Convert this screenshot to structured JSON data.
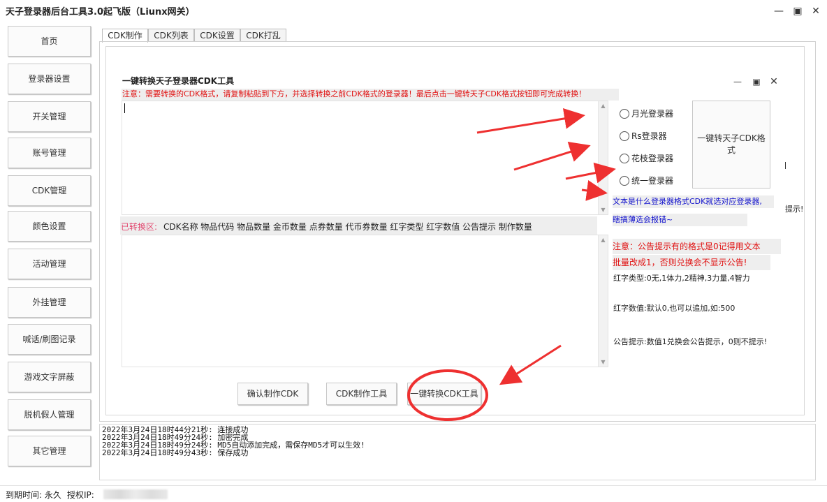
{
  "window": {
    "title": "天子登录器后台工具3.0起飞版（Liunx网关）"
  },
  "nav": [
    "首页",
    "登录器设置",
    "开关管理",
    "账号管理",
    "CDK管理",
    "颜色设置",
    "活动管理",
    "外挂管理",
    "喊话/刷图记录",
    "游戏文字屏蔽",
    "脱机假人管理",
    "其它管理"
  ],
  "tabs": [
    "CDK制作",
    "CDK列表",
    "CDK设置",
    "CDK打乱"
  ],
  "tool": {
    "title": "一键转换天子登录器CDK工具",
    "notice": "注意：需要转换的CDK格式，请复制粘贴到下方，并选择转换之前CDK格式的登录器！最后点击一键转天子CDK格式按钮即可完成转换！",
    "converted_label": "已转换区:",
    "converted_columns": "CDK名称 物品代码 物品数量 金币数量 点券数量 代币券数量 红字类型 红字数值 公告提示 制作数量",
    "radios": [
      "月光登录器",
      "Rs登录器",
      "花枝登录器",
      "统一登录器"
    ],
    "convert_button": "一键转天子CDK格式",
    "hint_line1": "文本是什么登录器格式CDK就选对应登录器,",
    "hint_line2": "瞎搞薄选会报错~",
    "side_clip": "提示!",
    "warn_line1": "注意：公告提示有的格式是0记得用文本",
    "warn_line2": "批量改成1，否则兑换会不显示公告!",
    "info_red_type": "红字类型:0无,1体力,2精神,3力量,4智力",
    "info_red_value": "红字数值:默认0,也可以追加,如:500",
    "info_notice": "公告提示:数值1兑换会公告提示，0则不提示!"
  },
  "buttons": {
    "confirm": "确认制作CDK",
    "cdk_tool": "CDK制作工具",
    "convert_tool": "一键转换CDK工具"
  },
  "log": [
    "2022年3月24日18时44分21秒: 连接成功",
    "2022年3月24日18时49分24秒: 加密完成",
    "2022年3月24日18时49分24秒: MD5自动添加完成，需保存MD5才可以生效!",
    "2022年3月24日18时49分43秒: 保存成功"
  ],
  "status": {
    "expire": "到期时间: 永久",
    "ip_label": "授权IP:"
  },
  "colors": {
    "accent_red": "#e01010",
    "annotation_red": "#ee3030",
    "hint_blue": "#1010cc"
  }
}
